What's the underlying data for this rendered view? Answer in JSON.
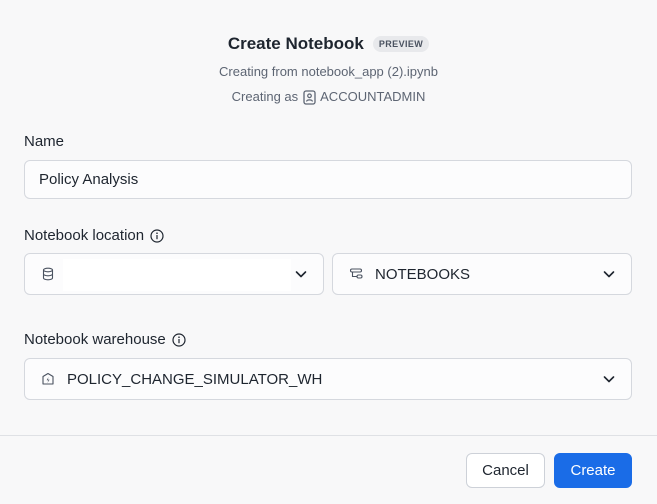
{
  "dialog": {
    "title": "Create Notebook",
    "badge": "PREVIEW",
    "subtitle": "Creating from notebook_app (2).ipynb",
    "role_prefix": "Creating as",
    "role": "ACCOUNTADMIN"
  },
  "name_field": {
    "label": "Name",
    "value": "Policy Analysis"
  },
  "location": {
    "label": "Notebook location",
    "database_value": "",
    "schema_value": "NOTEBOOKS"
  },
  "warehouse": {
    "label": "Notebook warehouse",
    "value": "POLICY_CHANGE_SIMULATOR_WH"
  },
  "footer": {
    "cancel_label": "Cancel",
    "create_label": "Create"
  },
  "colors": {
    "primary": "#1a6ce7",
    "background": "#f8f8f9",
    "border": "#d5d8de"
  }
}
